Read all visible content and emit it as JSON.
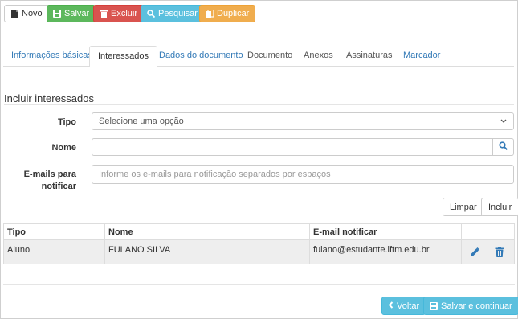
{
  "toolbar": {
    "novo": "Novo",
    "salvar": "Salvar",
    "excluir": "Excluir",
    "pesquisar": "Pesquisar",
    "duplicar": "Duplicar"
  },
  "tabs": [
    {
      "label": "Informações básicas"
    },
    {
      "label": "Interessados"
    },
    {
      "label": "Dados do documento"
    },
    {
      "label": "Documento"
    },
    {
      "label": "Anexos"
    },
    {
      "label": "Assinaturas"
    },
    {
      "label": "Marcador"
    }
  ],
  "section": {
    "title": "Incluir interessados"
  },
  "form": {
    "tipo_label": "Tipo",
    "tipo_value": "Selecione uma opção",
    "nome_label": "Nome",
    "nome_value": "",
    "emails_label_1": "E-mails para",
    "emails_label_2": "notificar",
    "emails_placeholder": "Informe os e-mails para notificação separados por espaços"
  },
  "actions": {
    "limpar": "Limpar",
    "incluir": "Incluir"
  },
  "table": {
    "headers": [
      "Tipo",
      "Nome",
      "E-mail notificar",
      ""
    ],
    "rows": [
      {
        "tipo": "Aluno",
        "nome": "FULANO SILVA",
        "email": "fulano@estudante.iftm.edu.br"
      }
    ]
  },
  "footer": {
    "voltar": "Voltar",
    "salvar_continuar": "Salvar e continuar"
  },
  "colors": {
    "success": "#5cb85c",
    "danger": "#d9534f",
    "info": "#5bc0de",
    "warning": "#f0ad4e",
    "link": "#337ab7"
  }
}
